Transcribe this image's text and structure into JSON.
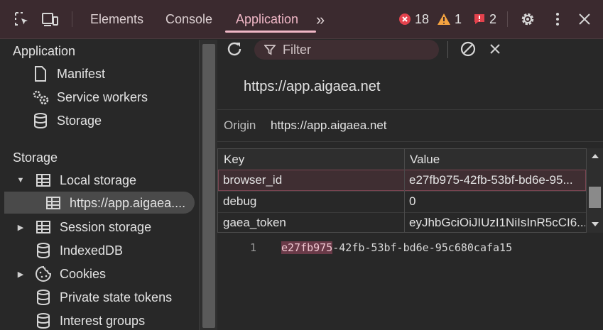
{
  "topbar": {
    "tabs": [
      {
        "label": "Elements"
      },
      {
        "label": "Console"
      },
      {
        "label": "Application"
      }
    ],
    "more_tabs": "»",
    "errors": "18",
    "warnings": "1",
    "issues": "2",
    "colors": {
      "accent": "#f0b7c6",
      "error": "#e3424d",
      "warning": "#f4a340"
    }
  },
  "sidebar": {
    "application_heading": "Application",
    "app_items": [
      {
        "label": "Manifest",
        "icon": "document-icon"
      },
      {
        "label": "Service workers",
        "icon": "gears-icon"
      },
      {
        "label": "Storage",
        "icon": "database-icon"
      }
    ],
    "storage_heading": "Storage",
    "storage_items": [
      {
        "label": "Local storage",
        "icon": "table-icon",
        "expanded": true
      },
      {
        "label": "https://app.aigaea....",
        "icon": "table-icon",
        "selected": true
      },
      {
        "label": "Session storage",
        "icon": "table-icon"
      },
      {
        "label": "IndexedDB",
        "icon": "database-icon"
      },
      {
        "label": "Cookies",
        "icon": "cookie-icon"
      },
      {
        "label": "Private state tokens",
        "icon": "database-icon"
      },
      {
        "label": "Interest groups",
        "icon": "database-icon"
      }
    ]
  },
  "main": {
    "filter_placeholder": "Filter",
    "origin_title": "https://app.aigaea.net",
    "origin_label": "Origin",
    "origin_value": "https://app.aigaea.net",
    "table": {
      "headers": [
        "Key",
        "Value"
      ],
      "rows": [
        {
          "key": "browser_id",
          "value": "e27fb975-42fb-53bf-bd6e-95..."
        },
        {
          "key": "debug",
          "value": "0"
        },
        {
          "key": "gaea_token",
          "value": "eyJhbGciOiJIUzI1NiIsInR5cCI6..."
        }
      ]
    },
    "preview": {
      "line_number": "1",
      "highlight": "e27fb975",
      "rest": "-42fb-53bf-bd6e-95c680cafa15"
    }
  }
}
